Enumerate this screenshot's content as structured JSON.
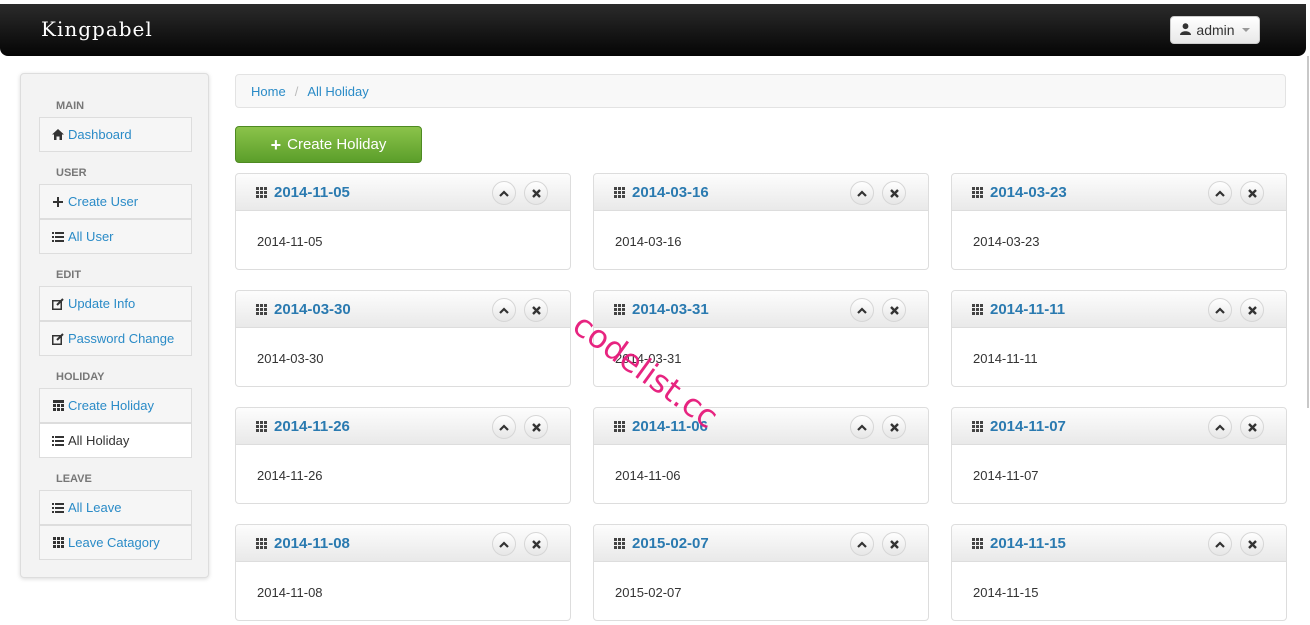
{
  "app": {
    "brand": "Kingpabel",
    "user_label": "admin"
  },
  "sidebar": {
    "sections": [
      {
        "header": "MAIN",
        "items": [
          {
            "label": "Dashboard",
            "icon": "home-icon"
          }
        ]
      },
      {
        "header": "USER",
        "items": [
          {
            "label": "Create User",
            "icon": "plus-icon"
          },
          {
            "label": "All User",
            "icon": "list-icon"
          }
        ]
      },
      {
        "header": "EDIT",
        "items": [
          {
            "label": "Update Info",
            "icon": "edit-icon"
          },
          {
            "label": "Password Change",
            "icon": "edit-icon"
          }
        ]
      },
      {
        "header": "HOLIDAY",
        "items": [
          {
            "label": "Create Holiday",
            "icon": "calendar-icon"
          },
          {
            "label": "All Holiday",
            "icon": "list-icon",
            "active": true
          }
        ]
      },
      {
        "header": "LEAVE",
        "items": [
          {
            "label": "All Leave",
            "icon": "list-icon"
          },
          {
            "label": "Leave Catagory",
            "icon": "grid-icon"
          }
        ]
      }
    ]
  },
  "breadcrumb": {
    "home": "Home",
    "separator": "/",
    "current": "All Holiday"
  },
  "create_button": {
    "icon": "+",
    "label": "Create Holiday"
  },
  "holidays": [
    {
      "title": "2014-11-05",
      "body": "2014-11-05"
    },
    {
      "title": "2014-03-16",
      "body": "2014-03-16"
    },
    {
      "title": "2014-03-23",
      "body": "2014-03-23"
    },
    {
      "title": "2014-03-30",
      "body": "2014-03-30"
    },
    {
      "title": "2014-03-31",
      "body": "2014-03-31"
    },
    {
      "title": "2014-11-11",
      "body": "2014-11-11"
    },
    {
      "title": "2014-11-26",
      "body": "2014-11-26"
    },
    {
      "title": "2014-11-06",
      "body": "2014-11-06"
    },
    {
      "title": "2014-11-07",
      "body": "2014-11-07"
    },
    {
      "title": "2014-11-08",
      "body": "2014-11-08"
    },
    {
      "title": "2015-02-07",
      "body": "2015-02-07"
    },
    {
      "title": "2014-11-15",
      "body": "2014-11-15"
    }
  ],
  "box_controls": {
    "collapse": "⌃",
    "close": "✖"
  },
  "watermark": "codelist.cc",
  "colors": {
    "link": "#2a8bc7",
    "button_green": "#6aab32",
    "navbar": "#111111"
  }
}
